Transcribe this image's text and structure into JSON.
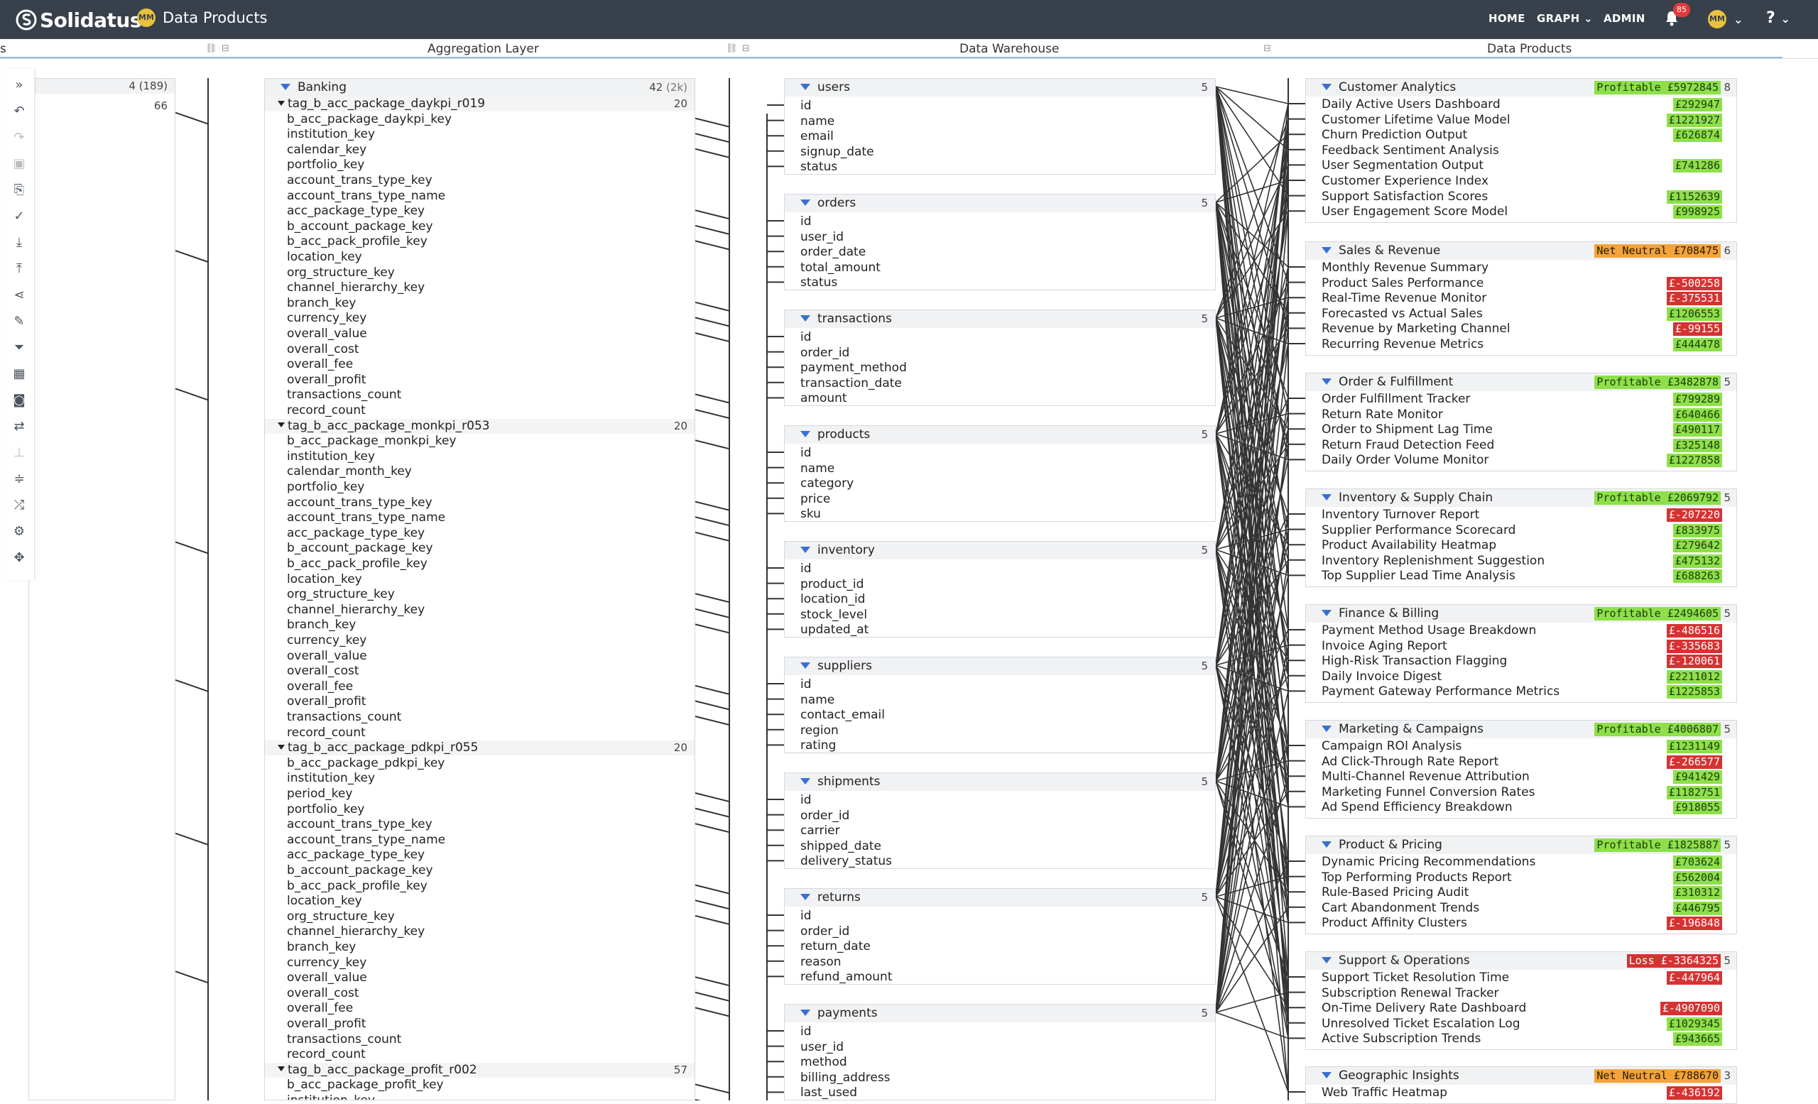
{
  "app": {
    "brand": "Solidatus",
    "project_avatar": "MM",
    "project_title": "Data Products"
  },
  "nav": {
    "home": "HOME",
    "graph": "GRAPH",
    "admin": "ADMIN",
    "notifications": "85",
    "user": "MM",
    "help": "?"
  },
  "layers": {
    "left": "s",
    "aggregation": "Aggregation Layer",
    "warehouse": "Data Warehouse",
    "products": "Data Products"
  },
  "left_panel": {
    "count1": "4 (189)",
    "count2": "66"
  },
  "banking": {
    "title": "Banking",
    "count": "42",
    "count_sub": "(2k)",
    "groups": [
      {
        "name": "tag_b_acc_package_daykpi_r019",
        "count": "20",
        "fields": [
          "b_acc_package_daykpi_key",
          "institution_key",
          "calendar_key",
          "portfolio_key",
          "account_trans_type_key",
          "account_trans_type_name",
          "acc_package_type_key",
          "b_account_package_key",
          "b_acc_pack_profile_key",
          "location_key",
          "org_structure_key",
          "channel_hierarchy_key",
          "branch_key",
          "currency_key",
          "overall_value",
          "overall_cost",
          "overall_fee",
          "overall_profit",
          "transactions_count",
          "record_count"
        ]
      },
      {
        "name": "tag_b_acc_package_monkpi_r053",
        "count": "20",
        "fields": [
          "b_acc_package_monkpi_key",
          "institution_key",
          "calendar_month_key",
          "portfolio_key",
          "account_trans_type_key",
          "account_trans_type_name",
          "acc_package_type_key",
          "b_account_package_key",
          "b_acc_pack_profile_key",
          "location_key",
          "org_structure_key",
          "channel_hierarchy_key",
          "branch_key",
          "currency_key",
          "overall_value",
          "overall_cost",
          "overall_fee",
          "overall_profit",
          "transactions_count",
          "record_count"
        ]
      },
      {
        "name": "tag_b_acc_package_pdkpi_r055",
        "count": "20",
        "fields": [
          "b_acc_package_pdkpi_key",
          "institution_key",
          "period_key",
          "portfolio_key",
          "account_trans_type_key",
          "account_trans_type_name",
          "acc_package_type_key",
          "b_account_package_key",
          "b_acc_pack_profile_key",
          "location_key",
          "org_structure_key",
          "channel_hierarchy_key",
          "branch_key",
          "currency_key",
          "overall_value",
          "overall_cost",
          "overall_fee",
          "overall_profit",
          "transactions_count",
          "record_count"
        ]
      },
      {
        "name": "tag_b_acc_package_profit_r002",
        "count": "57",
        "fields": [
          "b_acc_package_profit_key",
          "institution_key"
        ]
      }
    ]
  },
  "warehouse": [
    {
      "name": "users",
      "count": "5",
      "fields": [
        "id",
        "name",
        "email",
        "signup_date",
        "status"
      ]
    },
    {
      "name": "orders",
      "count": "5",
      "fields": [
        "id",
        "user_id",
        "order_date",
        "total_amount",
        "status"
      ]
    },
    {
      "name": "transactions",
      "count": "5",
      "fields": [
        "id",
        "order_id",
        "payment_method",
        "transaction_date",
        "amount"
      ]
    },
    {
      "name": "products",
      "count": "5",
      "fields": [
        "id",
        "name",
        "category",
        "price",
        "sku"
      ]
    },
    {
      "name": "inventory",
      "count": "5",
      "fields": [
        "id",
        "product_id",
        "location_id",
        "stock_level",
        "updated_at"
      ]
    },
    {
      "name": "suppliers",
      "count": "5",
      "fields": [
        "id",
        "name",
        "contact_email",
        "region",
        "rating"
      ]
    },
    {
      "name": "shipments",
      "count": "5",
      "fields": [
        "id",
        "order_id",
        "carrier",
        "shipped_date",
        "delivery_status"
      ]
    },
    {
      "name": "returns",
      "count": "5",
      "fields": [
        "id",
        "order_id",
        "return_date",
        "reason",
        "refund_amount"
      ]
    },
    {
      "name": "payments",
      "count": "5",
      "fields": [
        "id",
        "user_id",
        "method",
        "billing_address",
        "last_used"
      ]
    }
  ],
  "products": [
    {
      "name": "Customer Analytics",
      "status": "Profitable",
      "total": "£5972845",
      "status_type": "pos",
      "count": "8",
      "items": [
        {
          "label": "Daily Active Users Dashboard",
          "amount": "£292947",
          "type": "pos"
        },
        {
          "label": "Customer Lifetime Value Model",
          "amount": "£1221927",
          "type": "pos"
        },
        {
          "label": "Churn Prediction Output",
          "amount": "£626874",
          "type": "pos"
        },
        {
          "label": "Feedback Sentiment Analysis",
          "amount": "",
          "type": ""
        },
        {
          "label": "User Segmentation Output",
          "amount": "£741286",
          "type": "pos"
        },
        {
          "label": "Customer Experience Index",
          "amount": "",
          "type": ""
        },
        {
          "label": "Support Satisfaction Scores",
          "amount": "£1152639",
          "type": "pos"
        },
        {
          "label": "User Engagement Score Model",
          "amount": "£998925",
          "type": "pos"
        }
      ]
    },
    {
      "name": "Sales & Revenue",
      "status": "Net Neutral",
      "total": "£708475",
      "status_type": "neu",
      "count": "6",
      "items": [
        {
          "label": "Monthly Revenue Summary",
          "amount": "",
          "type": ""
        },
        {
          "label": "Product Sales Performance",
          "amount": "£-500258",
          "type": "neg"
        },
        {
          "label": "Real-Time Revenue Monitor",
          "amount": "£-375531",
          "type": "neg"
        },
        {
          "label": "Forecasted vs Actual Sales",
          "amount": "£1206553",
          "type": "pos"
        },
        {
          "label": "Revenue by Marketing Channel",
          "amount": "£-99155",
          "type": "neg"
        },
        {
          "label": "Recurring Revenue Metrics",
          "amount": "£444478",
          "type": "pos"
        }
      ]
    },
    {
      "name": "Order & Fulfillment",
      "status": "Profitable",
      "total": "£3482878",
      "status_type": "pos",
      "count": "5",
      "items": [
        {
          "label": "Order Fulfillment Tracker",
          "amount": "£799289",
          "type": "pos"
        },
        {
          "label": "Return Rate Monitor",
          "amount": "£640466",
          "type": "pos"
        },
        {
          "label": "Order to Shipment Lag Time",
          "amount": "£490117",
          "type": "pos"
        },
        {
          "label": "Return Fraud Detection Feed",
          "amount": "£325148",
          "type": "pos"
        },
        {
          "label": "Daily Order Volume Monitor",
          "amount": "£1227858",
          "type": "pos"
        }
      ]
    },
    {
      "name": "Inventory & Supply Chain",
      "status": "Profitable",
      "total": "£2069792",
      "status_type": "pos",
      "count": "5",
      "items": [
        {
          "label": "Inventory Turnover Report",
          "amount": "£-207220",
          "type": "neg"
        },
        {
          "label": "Supplier Performance Scorecard",
          "amount": "£833975",
          "type": "pos"
        },
        {
          "label": "Product Availability Heatmap",
          "amount": "£279642",
          "type": "pos"
        },
        {
          "label": "Inventory Replenishment Suggestion",
          "amount": "£475132",
          "type": "pos"
        },
        {
          "label": "Top Supplier Lead Time Analysis",
          "amount": "£688263",
          "type": "pos"
        }
      ]
    },
    {
      "name": "Finance & Billing",
      "status": "Profitable",
      "total": "£2494605",
      "status_type": "pos",
      "count": "5",
      "items": [
        {
          "label": "Payment Method Usage Breakdown",
          "amount": "£-486516",
          "type": "neg"
        },
        {
          "label": "Invoice Aging Report",
          "amount": "£-335683",
          "type": "neg"
        },
        {
          "label": "High-Risk Transaction Flagging",
          "amount": "£-120061",
          "type": "neg"
        },
        {
          "label": "Daily Invoice Digest",
          "amount": "£2211012",
          "type": "pos"
        },
        {
          "label": "Payment Gateway Performance Metrics",
          "amount": "£1225853",
          "type": "pos"
        }
      ]
    },
    {
      "name": "Marketing & Campaigns",
      "status": "Profitable",
      "total": "£4006807",
      "status_type": "pos",
      "count": "5",
      "items": [
        {
          "label": "Campaign ROI Analysis",
          "amount": "£1231149",
          "type": "pos"
        },
        {
          "label": "Ad Click-Through Rate Report",
          "amount": "£-266577",
          "type": "neg"
        },
        {
          "label": "Multi-Channel Revenue Attribution",
          "amount": "£941429",
          "type": "pos"
        },
        {
          "label": "Marketing Funnel Conversion Rates",
          "amount": "£1182751",
          "type": "pos"
        },
        {
          "label": "Ad Spend Efficiency Breakdown",
          "amount": "£918055",
          "type": "pos"
        }
      ]
    },
    {
      "name": "Product & Pricing",
      "status": "Profitable",
      "total": "£1825887",
      "status_type": "pos",
      "count": "5",
      "items": [
        {
          "label": "Dynamic Pricing Recommendations",
          "amount": "£703624",
          "type": "pos"
        },
        {
          "label": "Top Performing Products Report",
          "amount": "£562004",
          "type": "pos"
        },
        {
          "label": "Rule-Based Pricing Audit",
          "amount": "£310312",
          "type": "pos"
        },
        {
          "label": "Cart Abandonment Trends",
          "amount": "£446795",
          "type": "pos"
        },
        {
          "label": "Product Affinity Clusters",
          "amount": "£-196848",
          "type": "neg"
        }
      ]
    },
    {
      "name": "Support & Operations",
      "status": "Loss",
      "total": "£-3364325",
      "status_type": "neg",
      "count": "5",
      "items": [
        {
          "label": "Support Ticket Resolution Time",
          "amount": "£-447964",
          "type": "neg"
        },
        {
          "label": "Subscription Renewal Tracker",
          "amount": "",
          "type": ""
        },
        {
          "label": "On-Time Delivery Rate Dashboard",
          "amount": "£-4907090",
          "type": "neg"
        },
        {
          "label": "Unresolved Ticket Escalation Log",
          "amount": "£1029345",
          "type": "pos"
        },
        {
          "label": "Active Subscription Trends",
          "amount": "£943665",
          "type": "pos"
        }
      ]
    },
    {
      "name": "Geographic Insights",
      "status": "Net Neutral",
      "total": "£788670",
      "status_type": "neu",
      "count": "3",
      "items": [
        {
          "label": "Web Traffic Heatmap",
          "amount": "£-436192",
          "type": "neg"
        }
      ]
    }
  ]
}
